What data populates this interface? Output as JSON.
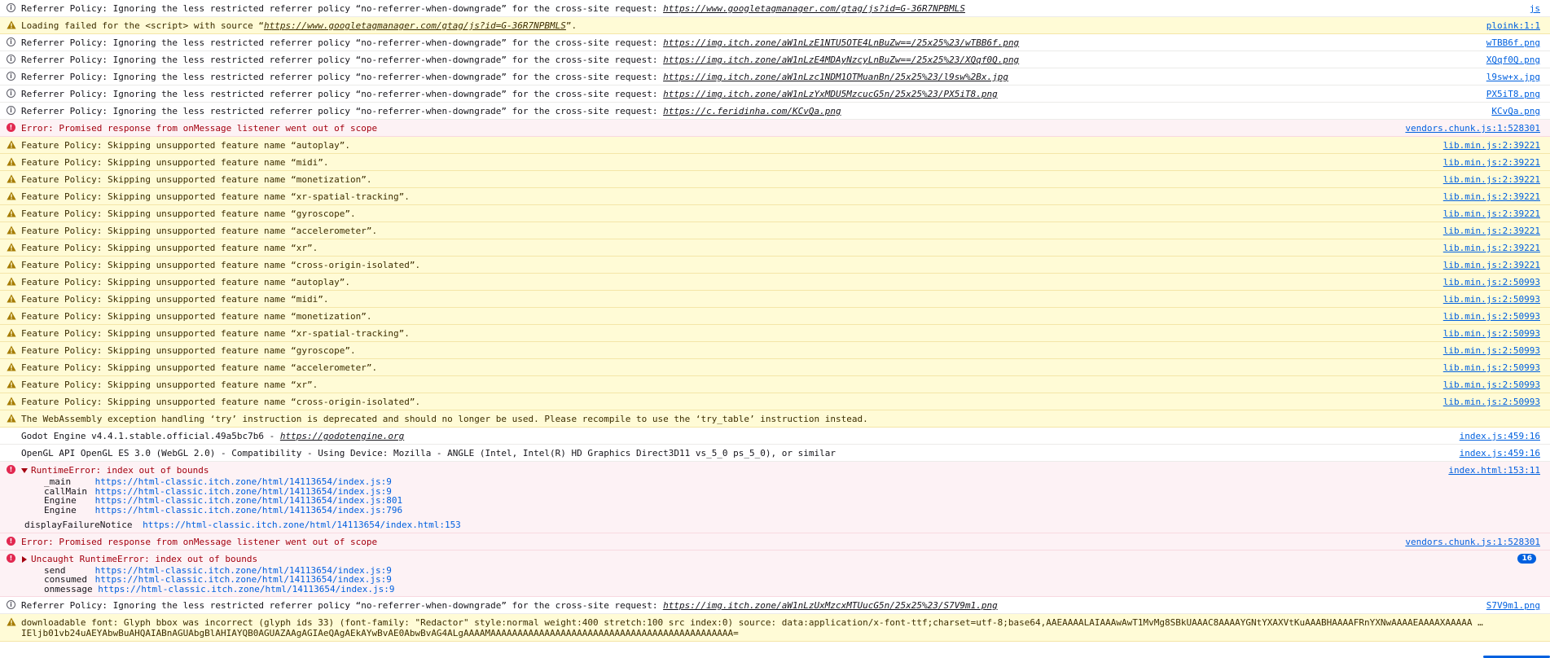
{
  "messages": [
    {
      "level": "info",
      "text": "Referrer Policy: Ignoring the less restricted referrer policy “no-referrer-when-downgrade” for the cross-site request: ",
      "link": "https://www.googletagmanager.com/gtag/js?id=G-36R7NPBMLS",
      "source": "js"
    },
    {
      "level": "warn",
      "text": "Loading failed for the <script> with source “",
      "link": "https://www.googletagmanager.com/gtag/js?id=G-36R7NPBMLS",
      "suffix": "”.",
      "source": "ploink:1:1"
    },
    {
      "level": "info",
      "text": "Referrer Policy: Ignoring the less restricted referrer policy “no-referrer-when-downgrade” for the cross-site request: ",
      "link": "https://img.itch.zone/aW1nLzE1NTU5OTE4LnBuZw==/25x25%23/wTBB6f.png",
      "source": "wTBB6f.png"
    },
    {
      "level": "info",
      "text": "Referrer Policy: Ignoring the less restricted referrer policy “no-referrer-when-downgrade” for the cross-site request: ",
      "link": "https://img.itch.zone/aW1nLzE4MDAyNzcyLnBuZw==/25x25%23/XQqf0Q.png",
      "source": "XQqf0Q.png"
    },
    {
      "level": "info",
      "text": "Referrer Policy: Ignoring the less restricted referrer policy “no-referrer-when-downgrade” for the cross-site request: ",
      "link": "https://img.itch.zone/aW1nLzc1NDM1OTMuanBn/25x25%23/l9sw%2Bx.jpg",
      "source": "l9sw+x.jpg"
    },
    {
      "level": "info",
      "text": "Referrer Policy: Ignoring the less restricted referrer policy “no-referrer-when-downgrade” for the cross-site request: ",
      "link": "https://img.itch.zone/aW1nLzYxMDU5MzcucG5n/25x25%23/PX5iT8.png",
      "source": "PX5iT8.png"
    },
    {
      "level": "info",
      "text": "Referrer Policy: Ignoring the less restricted referrer policy “no-referrer-when-downgrade” for the cross-site request: ",
      "link": "https://c.feridinha.com/KCvQa.png",
      "source": "KCvQa.png"
    },
    {
      "level": "error",
      "text": "Error: Promised response from onMessage listener went out of scope",
      "source": "vendors.chunk.js:1:528301"
    },
    {
      "level": "warn",
      "text": "Feature Policy: Skipping unsupported feature name “autoplay”.",
      "source": "lib.min.js:2:39221"
    },
    {
      "level": "warn",
      "text": "Feature Policy: Skipping unsupported feature name “midi”.",
      "source": "lib.min.js:2:39221"
    },
    {
      "level": "warn",
      "text": "Feature Policy: Skipping unsupported feature name “monetization”.",
      "source": "lib.min.js:2:39221"
    },
    {
      "level": "warn",
      "text": "Feature Policy: Skipping unsupported feature name “xr-spatial-tracking”.",
      "source": "lib.min.js:2:39221"
    },
    {
      "level": "warn",
      "text": "Feature Policy: Skipping unsupported feature name “gyroscope”.",
      "source": "lib.min.js:2:39221"
    },
    {
      "level": "warn",
      "text": "Feature Policy: Skipping unsupported feature name “accelerometer”.",
      "source": "lib.min.js:2:39221"
    },
    {
      "level": "warn",
      "text": "Feature Policy: Skipping unsupported feature name “xr”.",
      "source": "lib.min.js:2:39221"
    },
    {
      "level": "warn",
      "text": "Feature Policy: Skipping unsupported feature name “cross-origin-isolated”.",
      "source": "lib.min.js:2:39221"
    },
    {
      "level": "warn",
      "text": "Feature Policy: Skipping unsupported feature name “autoplay”.",
      "source": "lib.min.js:2:50993"
    },
    {
      "level": "warn",
      "text": "Feature Policy: Skipping unsupported feature name “midi”.",
      "source": "lib.min.js:2:50993"
    },
    {
      "level": "warn",
      "text": "Feature Policy: Skipping unsupported feature name “monetization”.",
      "source": "lib.min.js:2:50993"
    },
    {
      "level": "warn",
      "text": "Feature Policy: Skipping unsupported feature name “xr-spatial-tracking”.",
      "source": "lib.min.js:2:50993"
    },
    {
      "level": "warn",
      "text": "Feature Policy: Skipping unsupported feature name “gyroscope”.",
      "source": "lib.min.js:2:50993"
    },
    {
      "level": "warn",
      "text": "Feature Policy: Skipping unsupported feature name “accelerometer”.",
      "source": "lib.min.js:2:50993"
    },
    {
      "level": "warn",
      "text": "Feature Policy: Skipping unsupported feature name “xr”.",
      "source": "lib.min.js:2:50993"
    },
    {
      "level": "warn",
      "text": "Feature Policy: Skipping unsupported feature name “cross-origin-isolated”.",
      "source": "lib.min.js:2:50993"
    },
    {
      "level": "warn",
      "text": "The WebAssembly exception handling ‘try’ instruction is deprecated and should no longer be used. Please recompile to use the ‘try_table’ instruction instead."
    },
    {
      "level": "log",
      "text": "Godot Engine v4.4.1.stable.official.49a5bc7b6 - ",
      "link": "https://godotengine.org",
      "source": "index.js:459:16"
    },
    {
      "level": "log",
      "text": "OpenGL API OpenGL ES 3.0 (WebGL 2.0) - Compatibility - Using Device: Mozilla - ANGLE (Intel, Intel(R) HD Graphics Direct3D11 vs_5_0 ps_5_0), or similar",
      "source": "index.js:459:16"
    },
    {
      "level": "error",
      "expanded": true,
      "text": "RuntimeError: index out of bounds",
      "source": "index.html:153:11",
      "trace": [
        {
          "fn": "_main",
          "loc": "https://html-classic.itch.zone/html/14113654/index.js:9"
        },
        {
          "fn": "callMain",
          "loc": "https://html-classic.itch.zone/html/14113654/index.js:9"
        },
        {
          "fn": "Engine",
          "loc": "https://html-classic.itch.zone/html/14113654/index.js:801"
        },
        {
          "fn": "Engine",
          "loc": "https://html-classic.itch.zone/html/14113654/index.js:796"
        },
        {
          "fn": "displayFailureNotice",
          "loc": "https://html-classic.itch.zone/html/14113654/index.html:153",
          "gap": true
        }
      ]
    },
    {
      "level": "error",
      "text": "Error: Promised response from onMessage listener went out of scope",
      "source": "vendors.chunk.js:1:528301"
    },
    {
      "level": "error",
      "expanded": false,
      "text": "Uncaught RuntimeError: index out of bounds",
      "badge": "16",
      "trace": [
        {
          "fn": "send",
          "loc": "https://html-classic.itch.zone/html/14113654/index.js:9"
        },
        {
          "fn": "consumed",
          "loc": "https://html-classic.itch.zone/html/14113654/index.js:9"
        },
        {
          "fn": "onmessage",
          "loc": "https://html-classic.itch.zone/html/14113654/index.js:9"
        }
      ]
    },
    {
      "level": "info",
      "text": "Referrer Policy: Ignoring the less restricted referrer policy “no-referrer-when-downgrade” for the cross-site request: ",
      "link": "https://img.itch.zone/aW1nLzUxMzcxMTUucG5n/25x25%23/S7V9m1.png",
      "source": "S7V9m1.png"
    },
    {
      "level": "warn",
      "font": true,
      "text": "downloadable font: Glyph bbox was incorrect (glyph ids 33) (font-family: \"Redactor\" style:normal weight:400 stretch:100 src index:0) source: data:application/x-font-ttf;charset=utf-8;base64,AAEAAAALAIAAAwAwT1MvMg8SBkUAAAC8AAAAYGNtYXAXVtKuAAABHAAAAFRnYXNwAAAAEAAAAXAAAAA …",
      "text2": "IEljb01vb24uAEYAbwBuAHQAIABnAGUAbgBlAHIAYQB0AGUAZAAgAGIAeQAgAEkAYwBvAE0AbwBvAG4ALgAAAAMAAAAAAAAAAAAAAAAAAAAAAAAAAAAAAAAAAAAAAAAAAAAA="
    }
  ]
}
